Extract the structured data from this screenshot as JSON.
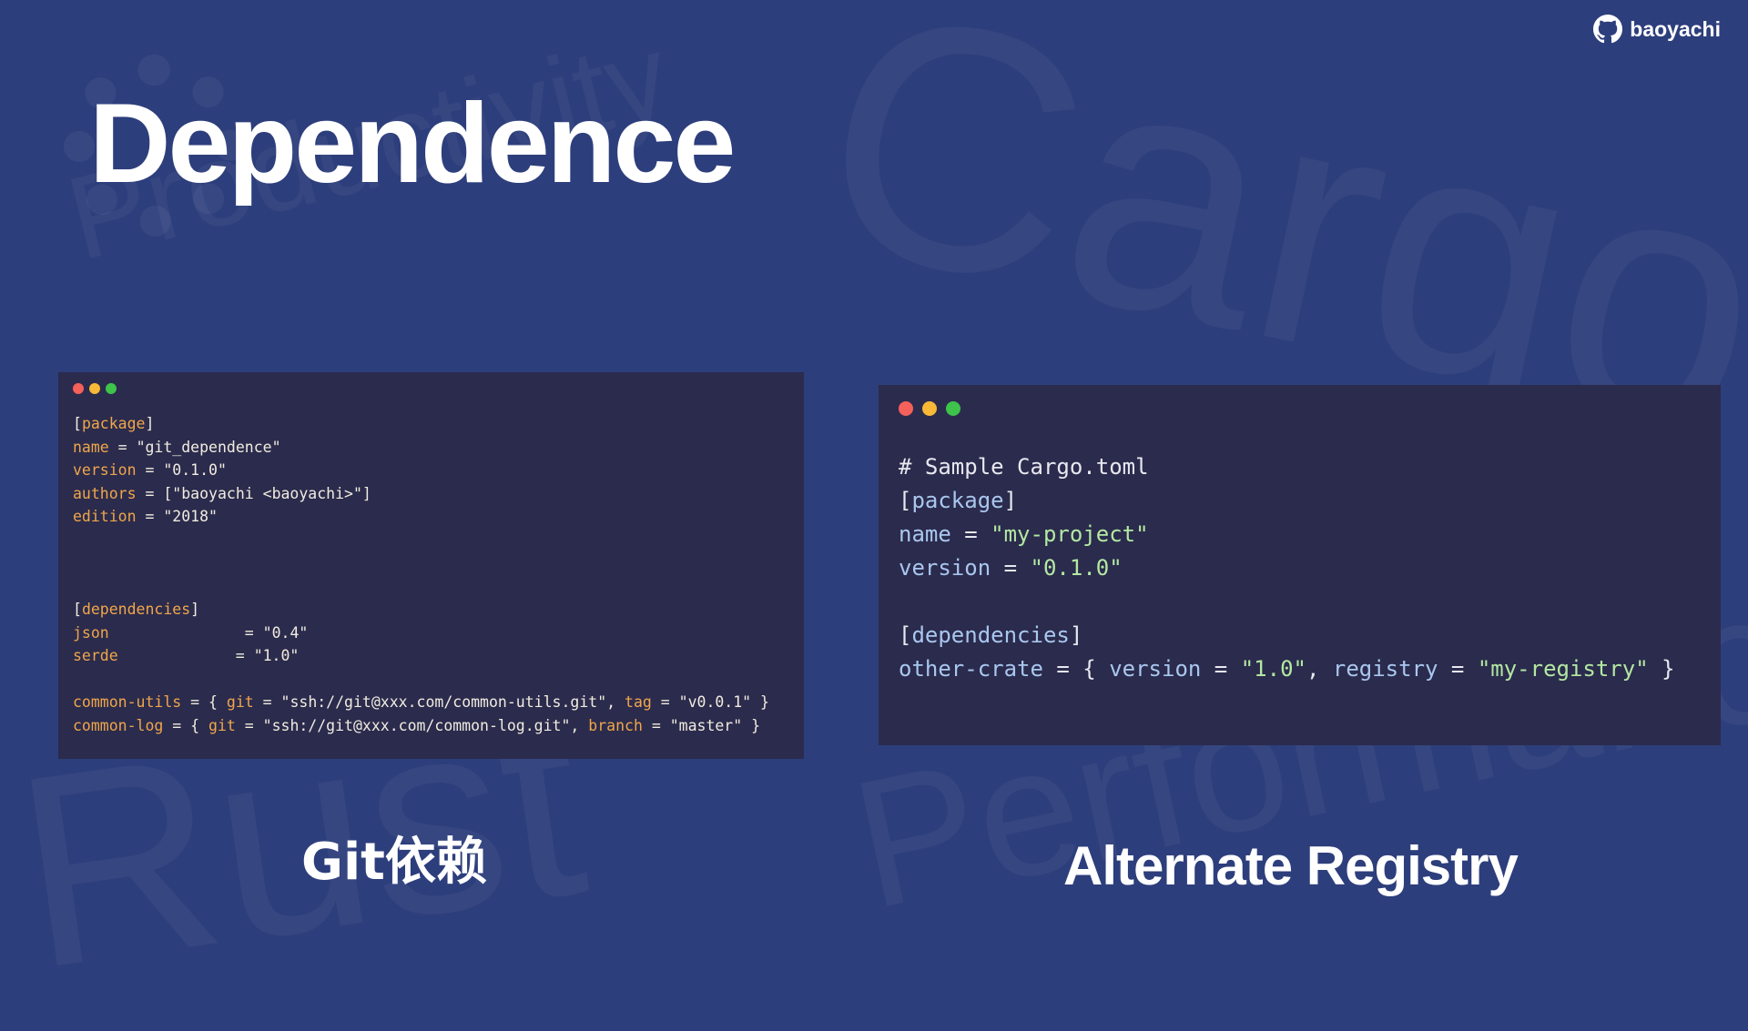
{
  "brand": {
    "icon": "github-icon",
    "name": "baoyachi"
  },
  "title": "Dependence",
  "background_words": [
    "Cargo",
    "Productivity",
    "Rust",
    "Performance"
  ],
  "left_panel": {
    "dots": [
      "#f4605a",
      "#f7b936",
      "#3ec34b"
    ],
    "code": [
      "[package]",
      "name = \"git_dependence\"",
      "version = \"0.1.0\"",
      "authors = [\"baoyachi <baoyachi>\"]",
      "edition = \"2018\"",
      "",
      "",
      "",
      "[dependencies]",
      "json               = \"0.4\"",
      "serde             = \"1.0\"",
      "",
      "common-utils = { git = \"ssh://git@xxx.com/common-utils.git\", tag = \"v0.0.1\" }",
      "common-log = { git = \"ssh://git@xxx.com/common-log.git\", branch = \"master\" }"
    ],
    "caption": "Git依赖"
  },
  "right_panel": {
    "dots": [
      "#f4605a",
      "#f7b936",
      "#3ec34b"
    ],
    "code": [
      "# Sample Cargo.toml",
      "[package]",
      "name = \"my-project\"",
      "version = \"0.1.0\"",
      "",
      "[dependencies]",
      "other-crate = { version = \"1.0\", registry = \"my-registry\" }"
    ],
    "caption": "Alternate Registry"
  },
  "colors": {
    "background": "#2d3e7c",
    "code_bg": "#2b2b4d",
    "left_key": "#f0a64a",
    "right_key": "#a9c7ee",
    "right_string": "#b3e8a2"
  }
}
